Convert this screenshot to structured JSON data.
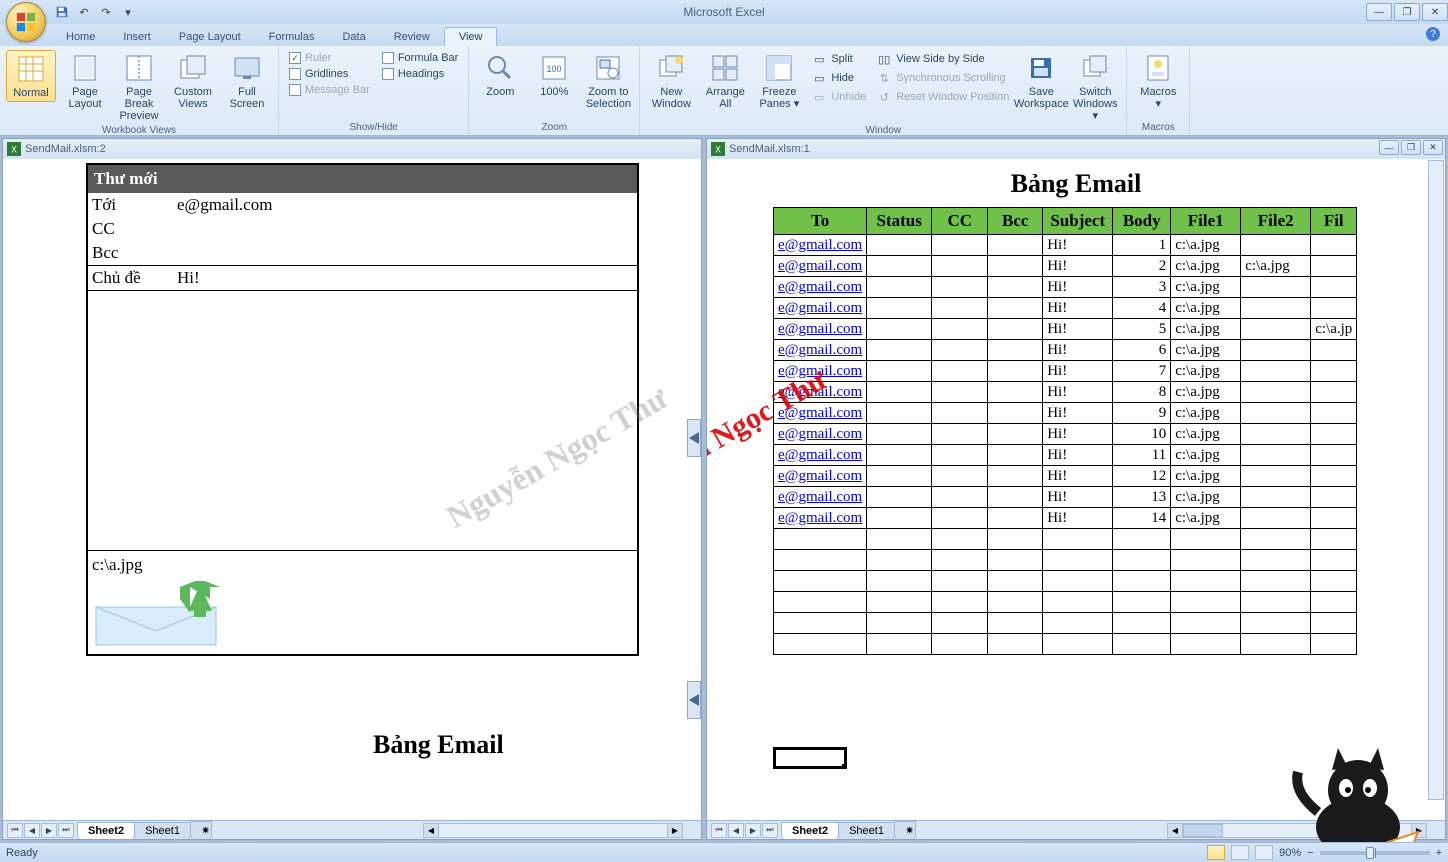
{
  "app_title": "Microsoft Excel",
  "qat": {
    "save": "💾",
    "undo": "↶",
    "redo": "↷"
  },
  "tabs": [
    "Home",
    "Insert",
    "Page Layout",
    "Formulas",
    "Data",
    "Review",
    "View"
  ],
  "active_tab": "View",
  "ribbon": {
    "workbook_views": {
      "label": "Workbook Views",
      "normal": "Normal",
      "page_layout": "Page\nLayout",
      "page_break": "Page Break\nPreview",
      "custom_views": "Custom\nViews",
      "full_screen": "Full\nScreen"
    },
    "show_hide": {
      "label": "Show/Hide",
      "ruler": "Ruler",
      "gridlines": "Gridlines",
      "message_bar": "Message Bar",
      "formula_bar": "Formula Bar",
      "headings": "Headings"
    },
    "zoom_group": {
      "label": "Zoom",
      "zoom": "Zoom",
      "hundred": "100%",
      "to_selection": "Zoom to\nSelection"
    },
    "window_group": {
      "label": "Window",
      "new_window": "New\nWindow",
      "arrange_all": "Arrange\nAll",
      "freeze": "Freeze\nPanes ▾",
      "split": "Split",
      "hide": "Hide",
      "unhide": "Unhide",
      "side_by_side": "View Side by Side",
      "sync_scroll": "Synchronous Scrolling",
      "reset_pos": "Reset Window Position",
      "save_ws": "Save\nWorkspace",
      "switch": "Switch\nWindows ▾"
    },
    "macros_group": {
      "label": "Macros",
      "macros": "Macros\n▾"
    }
  },
  "left_window": {
    "title": "SendMail.xlsm:2",
    "form": {
      "header": "Thư mới",
      "to_label": "Tới",
      "to_value": "e@gmail.com",
      "cc_label": "CC",
      "bcc_label": "Bcc",
      "subject_label": "Chủ đề",
      "subject_value": "Hi!",
      "attachment": "c:\\a.jpg"
    },
    "bottom_title": "Bảng Email"
  },
  "right_window": {
    "title": "SendMail.xlsm:1",
    "table_title": "Bảng Email",
    "headers": [
      "To",
      "Status",
      "CC",
      "Bcc",
      "Subject",
      "Body",
      "File1",
      "File2",
      "Fil"
    ],
    "rows": [
      {
        "to": "e@gmail.com",
        "subject": "Hi!",
        "body": "1",
        "file1": "c:\\a.jpg",
        "file2": ""
      },
      {
        "to": "e@gmail.com",
        "subject": "Hi!",
        "body": "2",
        "file1": "c:\\a.jpg",
        "file2": "c:\\a.jpg"
      },
      {
        "to": "e@gmail.com",
        "subject": "Hi!",
        "body": "3",
        "file1": "c:\\a.jpg",
        "file2": ""
      },
      {
        "to": "e@gmail.com",
        "subject": "Hi!",
        "body": "4",
        "file1": "c:\\a.jpg",
        "file2": ""
      },
      {
        "to": "e@gmail.com",
        "subject": "Hi!",
        "body": "5",
        "file1": "c:\\a.jpg",
        "file2": "",
        "file3": "c:\\a.jp"
      },
      {
        "to": "e@gmail.com",
        "subject": "Hi!",
        "body": "6",
        "file1": "c:\\a.jpg",
        "file2": ""
      },
      {
        "to": "e@gmail.com",
        "subject": "Hi!",
        "body": "7",
        "file1": "c:\\a.jpg",
        "file2": ""
      },
      {
        "to": "e@gmail.com",
        "subject": "Hi!",
        "body": "8",
        "file1": "c:\\a.jpg",
        "file2": ""
      },
      {
        "to": "e@gmail.com",
        "subject": "Hi!",
        "body": "9",
        "file1": "c:\\a.jpg",
        "file2": ""
      },
      {
        "to": "e@gmail.com",
        "subject": "Hi!",
        "body": "10",
        "file1": "c:\\a.jpg",
        "file2": ""
      },
      {
        "to": "e@gmail.com",
        "subject": "Hi!",
        "body": "11",
        "file1": "c:\\a.jpg",
        "file2": ""
      },
      {
        "to": "e@gmail.com",
        "subject": "Hi!",
        "body": "12",
        "file1": "c:\\a.jpg",
        "file2": ""
      },
      {
        "to": "e@gmail.com",
        "subject": "Hi!",
        "body": "13",
        "file1": "c:\\a.jpg",
        "file2": ""
      },
      {
        "to": "e@gmail.com",
        "subject": "Hi!",
        "body": "14",
        "file1": "c:\\a.jpg",
        "file2": ""
      }
    ],
    "empty_rows": 6
  },
  "sheet_tabs": {
    "active": "Sheet2",
    "other": "Sheet1"
  },
  "watermark_gray": "Nguyễn Ngọc Thư",
  "watermark_red": "Nguyễn Ngọc Thư",
  "status": {
    "ready": "Ready",
    "zoom": "90%"
  }
}
